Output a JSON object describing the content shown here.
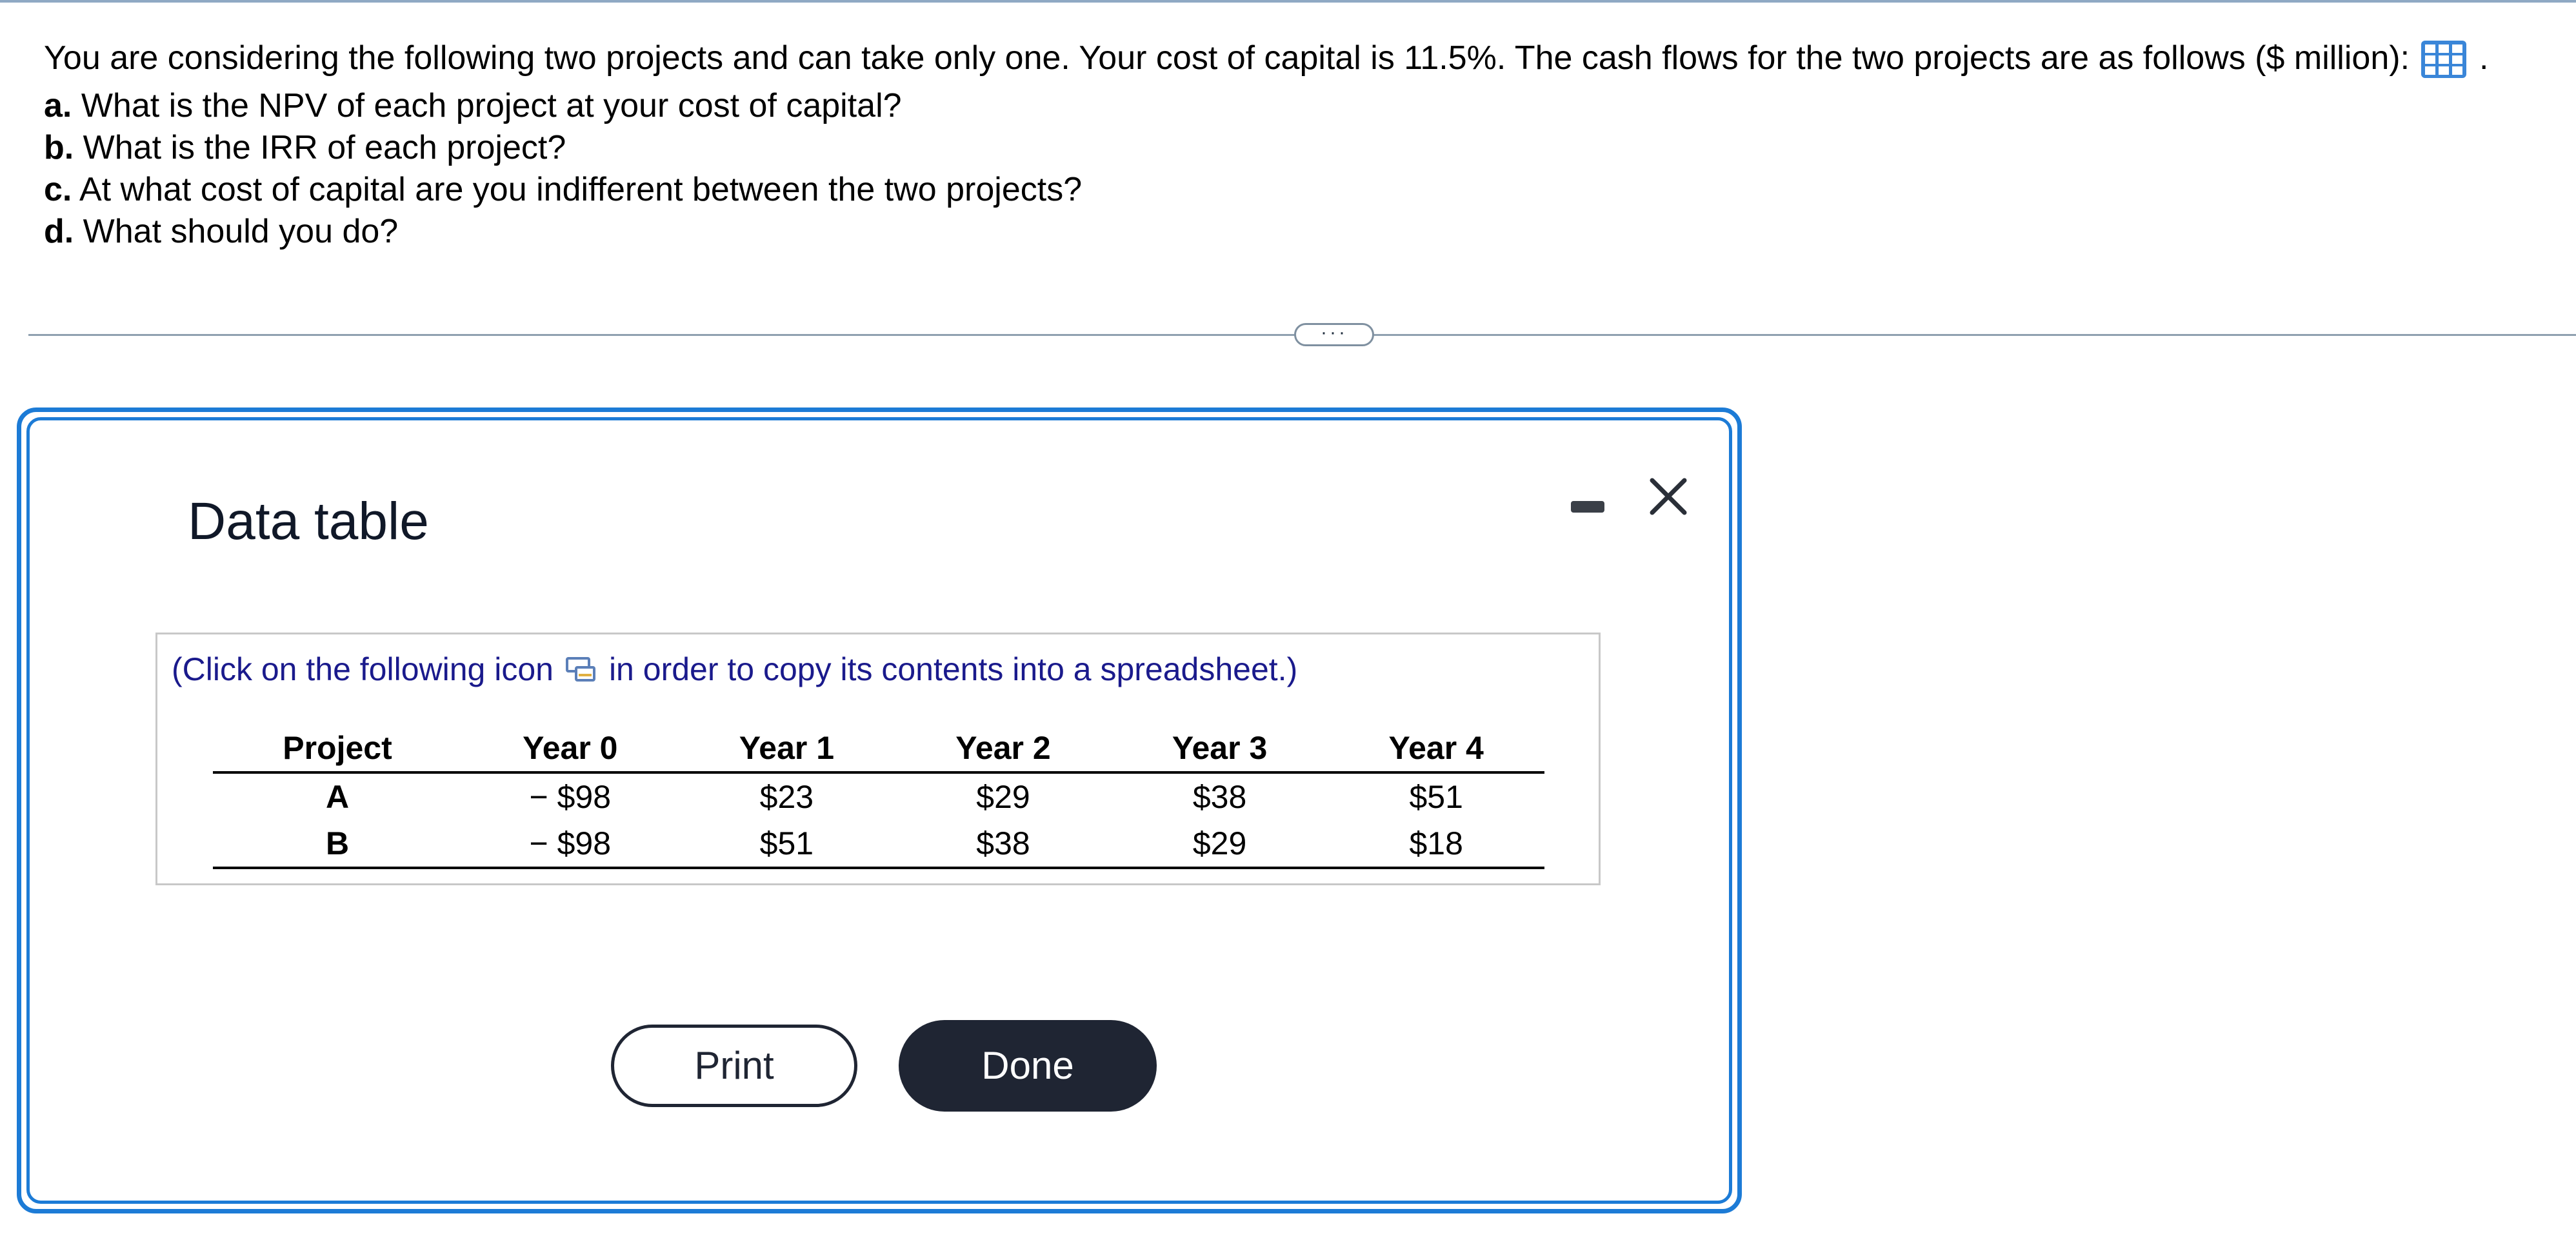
{
  "question": {
    "intro": "You are considering the following two projects and can take only one. Your cost of capital is 11.5%. The cash flows for the two projects are as follows ($ million):",
    "intro_end": ".",
    "table_icon": "table-grid-icon",
    "parts": [
      {
        "letter": "a.",
        "text": "What is the NPV of each project at your cost of capital?"
      },
      {
        "letter": "b.",
        "text": "What is the IRR of each project?"
      },
      {
        "letter": "c.",
        "text": "At what cost of capital are you indifferent between the two projects?"
      },
      {
        "letter": "d.",
        "text": "What should you do?"
      }
    ]
  },
  "divider": {
    "more_label": "···"
  },
  "dialog": {
    "title": "Data table",
    "minimize_icon": "minimize-icon",
    "close_icon": "close-icon",
    "copy_note_before": "(Click on the following icon",
    "copy_note_after": "in order to copy its contents into a spreadsheet.)",
    "copy_icon": "copy-spreadsheet-icon",
    "table": {
      "headers": [
        "Project",
        "Year 0",
        "Year 1",
        "Year 2",
        "Year 3",
        "Year 4"
      ],
      "rows": [
        [
          "A",
          "− $98",
          "$23",
          "$29",
          "$38",
          "$51"
        ],
        [
          "B",
          "− $98",
          "$51",
          "$38",
          "$29",
          "$18"
        ]
      ]
    },
    "print_label": "Print",
    "done_label": "Done"
  },
  "colors": {
    "accent_blue": "#1c7bd6",
    "dark_button": "#1f2533",
    "note_text": "#1a1a8c"
  }
}
